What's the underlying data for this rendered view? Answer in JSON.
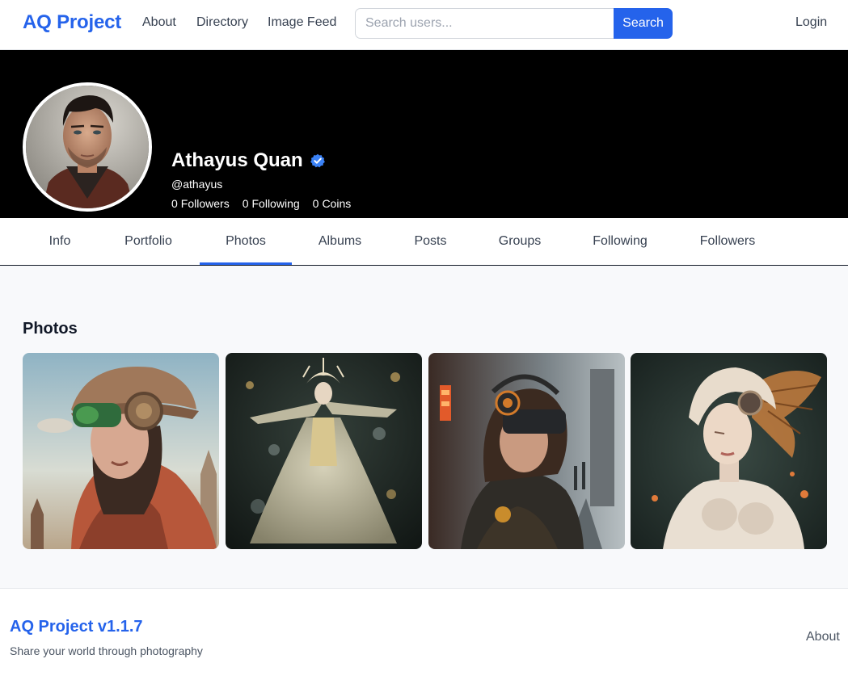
{
  "navbar": {
    "brand": "AQ Project",
    "links": [
      "About",
      "Directory",
      "Image Feed"
    ],
    "search_placeholder": "Search users...",
    "search_button": "Search",
    "login": "Login"
  },
  "profile": {
    "name": "Athayus Quan",
    "verified": true,
    "handle": "@athayus",
    "followers_count": "0",
    "followers_label": "Followers",
    "following_count": "0",
    "following_label": "Following",
    "coins_count": "0",
    "coins_label": "Coins"
  },
  "tabs": [
    {
      "label": "Info",
      "active": false
    },
    {
      "label": "Portfolio",
      "active": false
    },
    {
      "label": "Photos",
      "active": true
    },
    {
      "label": "Albums",
      "active": false
    },
    {
      "label": "Posts",
      "active": false
    },
    {
      "label": "Groups",
      "active": false
    },
    {
      "label": "Following",
      "active": false
    },
    {
      "label": "Followers",
      "active": false
    }
  ],
  "photos_section": {
    "title": "Photos",
    "photos": [
      {
        "description": "steampunk-woman-goggles"
      },
      {
        "description": "ethereal-dancer-bubbles"
      },
      {
        "description": "cyberpunk-vr-headset-street"
      },
      {
        "description": "biomechanical-winged-woman"
      }
    ]
  },
  "footer": {
    "brand": "AQ Project v1.1.7",
    "tagline": "Share your world through photography",
    "about": "About"
  },
  "colors": {
    "accent": "#2563eb",
    "header_bg": "#000000",
    "content_bg": "#f8f9fb"
  }
}
